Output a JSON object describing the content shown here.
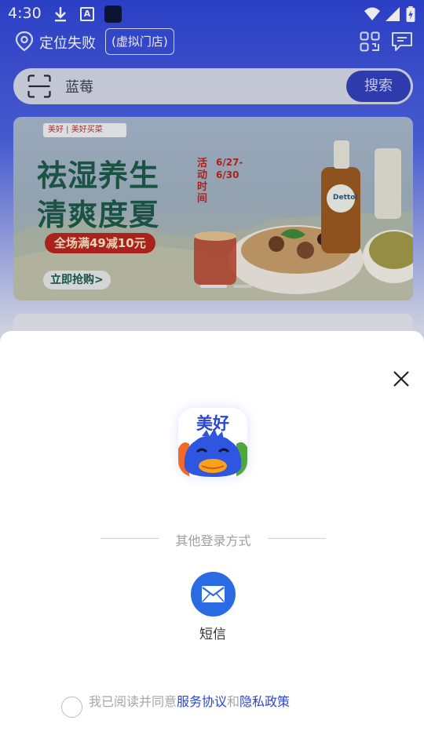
{
  "status_bar": {
    "time": "4:30",
    "icons": [
      "download-icon",
      "app-a-icon",
      "app-square-icon",
      "wifi-icon",
      "signal-icon",
      "battery-charging-icon"
    ],
    "app_a_glyph": "A"
  },
  "header": {
    "location_text": "定位失败",
    "virtual_store_label": "(虚拟门店)",
    "icons": [
      "location-pin-icon",
      "scan-code-icon",
      "message-icon"
    ]
  },
  "search": {
    "placeholder": "蓝莓",
    "button_label": "搜索",
    "icon": "scan-icon"
  },
  "banner": {
    "logo_text": "美好 | 美好买菜",
    "title_line1": "祛湿养生",
    "title_line2": "清爽度夏",
    "tag": "全场满49减10元",
    "cta": "立即抢购>",
    "vertical_label": "活动时间",
    "dates": "6/27-6/30",
    "product_label": "Dettol",
    "carousel_active_index": 0,
    "carousel_count": 2
  },
  "login_sheet": {
    "app_logo_text": "美好",
    "other_methods_label": "其他登录方式",
    "sms_label": "短信",
    "agreement_prefix": "我已阅读并同意",
    "agreement_service_link": "服务协议",
    "agreement_and": "和",
    "agreement_privacy_link": "隐私政策",
    "agreement_checked": false
  },
  "colors": {
    "accent": "#2a46cf",
    "sms_button": "#2a6be4",
    "search_button": "#3240bb",
    "banner_red": "#b9251f",
    "banner_green": "#1d5a4a"
  }
}
